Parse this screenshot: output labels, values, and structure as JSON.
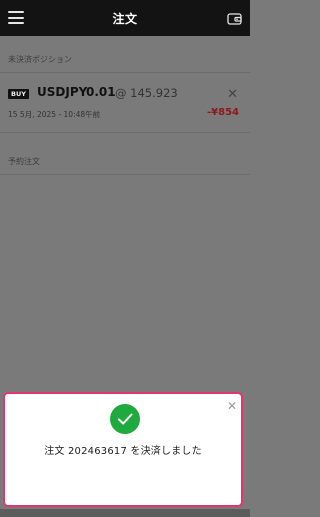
{
  "header": {
    "title": "注文"
  },
  "open_positions": {
    "label": "未決済ポジション",
    "position": {
      "side": "BUY",
      "symbol": "USDJPY",
      "quantity": "0.01",
      "price": "@ 145.923",
      "timestamp": "15 5月, 2025 - 10:48午前",
      "pnl": "-¥854"
    }
  },
  "pending_orders": {
    "label": "予約注文"
  },
  "toast": {
    "message": "注文 202463617 を決済しました"
  },
  "colors": {
    "toast_border": "#e2366f",
    "success": "#1faa3e",
    "loss": "#8b1a1a"
  }
}
